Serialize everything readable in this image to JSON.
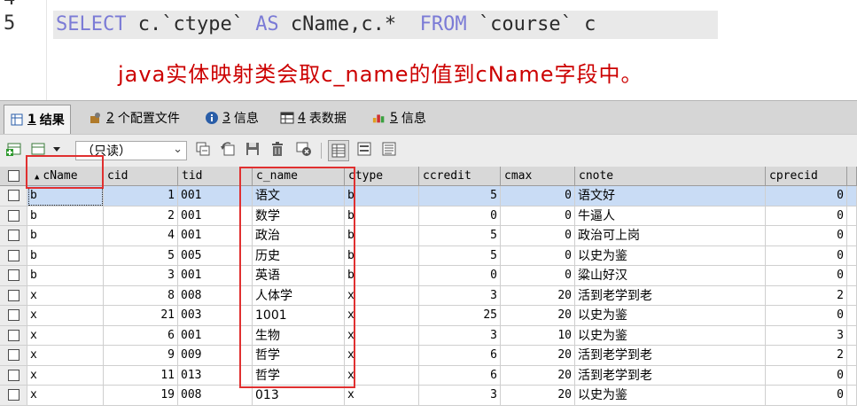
{
  "editor": {
    "line_numbers": [
      "4",
      "5"
    ],
    "sql_keyword_select": "SELECT",
    "sql_mid": " c.`ctype` ",
    "sql_keyword_as": "AS",
    "sql_mid2": " cName,c.*  ",
    "sql_keyword_from": "FROM",
    "sql_tail": " `course` c",
    "note": "java实体映射类会取c_name的值到cName字段中。",
    "colors": {
      "keyword": "#7b7bd6",
      "note": "#cc0000"
    }
  },
  "tabs": [
    {
      "num": "1",
      "label": "结果",
      "icon": "result-grid-icon"
    },
    {
      "num": "2",
      "label": "个配置文件",
      "icon": "profile-icon"
    },
    {
      "num": "3",
      "label": "信息",
      "icon": "info-icon"
    },
    {
      "num": "4",
      "label": "表数据",
      "icon": "table-data-icon"
    },
    {
      "num": "5",
      "label": "信息",
      "icon": "info-chart-icon"
    }
  ],
  "toolbar": {
    "mode_select": "（只读）",
    "icons": [
      "add-row-icon",
      "save-export-icon",
      "copy-icon",
      "revert-icon",
      "save-icon",
      "delete-icon",
      "delete-all-icon",
      "grid-view-icon",
      "form-view-icon",
      "text-view-icon"
    ]
  },
  "grid": {
    "columns": [
      "cName",
      "cid",
      "tid",
      "c_name",
      "ctype",
      "ccredit",
      "cmax",
      "cnote",
      "cprecid"
    ],
    "sort_column": "cName",
    "rows": [
      [
        "b",
        "1",
        "001",
        "语文",
        "b",
        "5",
        "0",
        "语文好",
        "0"
      ],
      [
        "b",
        "2",
        "001",
        "数学",
        "b",
        "0",
        "0",
        "牛逼人",
        "0"
      ],
      [
        "b",
        "4",
        "001",
        "政治",
        "b",
        "5",
        "0",
        "政治可上岗",
        "0"
      ],
      [
        "b",
        "5",
        "005",
        "历史",
        "b",
        "5",
        "0",
        "以史为鉴",
        "0"
      ],
      [
        "b",
        "3",
        "001",
        "英语",
        "b",
        "0",
        "0",
        "粱山好汉",
        "0"
      ],
      [
        "x",
        "8",
        "008",
        "人体学",
        "x",
        "3",
        "20",
        "活到老学到老",
        "2"
      ],
      [
        "x",
        "21",
        "003",
        "1001",
        "x",
        "25",
        "20",
        "以史为鉴",
        "0"
      ],
      [
        "x",
        "6",
        "001",
        "生物",
        "x",
        "3",
        "10",
        "以史为鉴",
        "3"
      ],
      [
        "x",
        "9",
        "009",
        "哲学",
        "x",
        "6",
        "20",
        "活到老学到老",
        "2"
      ],
      [
        "x",
        "11",
        "013",
        "哲学",
        "x",
        "6",
        "20",
        "活到老学到老",
        "0"
      ],
      [
        "x",
        "19",
        "008",
        "013",
        "x",
        "3",
        "20",
        "以史为鉴",
        "0"
      ]
    ],
    "selected_row": 0
  }
}
